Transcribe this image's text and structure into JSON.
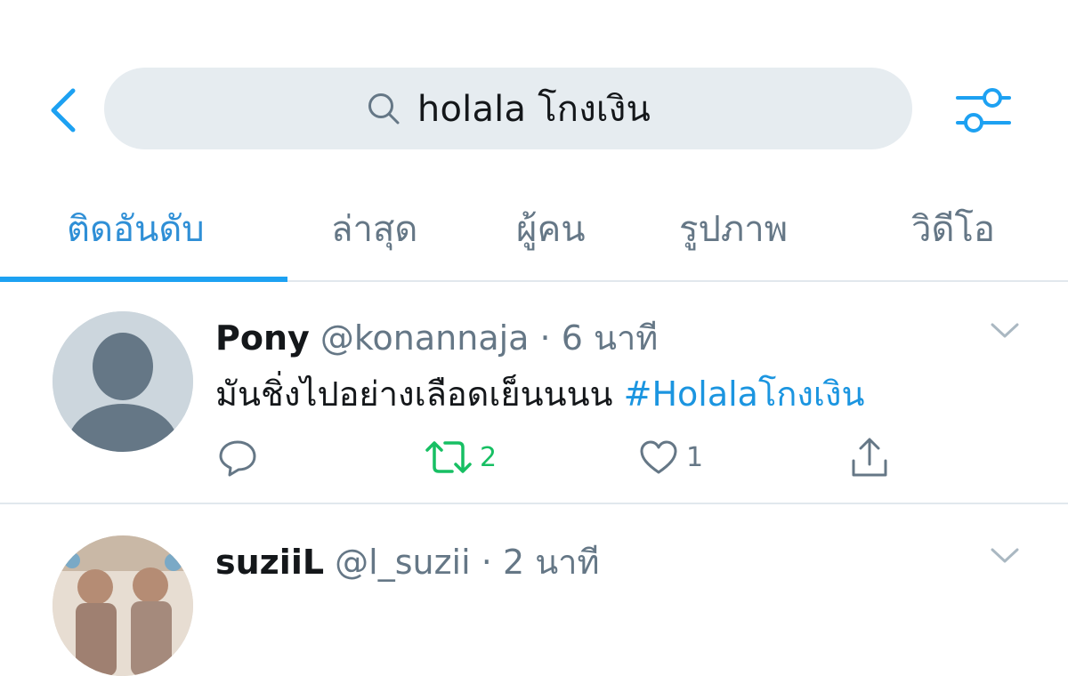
{
  "search": {
    "query": "holala โกงเงิน",
    "icons": {
      "back": "chevron-left-icon",
      "search": "search-icon",
      "filter": "sliders-icon"
    }
  },
  "tabs": [
    {
      "label": "ติดอันดับ",
      "active": true
    },
    {
      "label": "ล่าสุด",
      "active": false
    },
    {
      "label": "ผู้คน",
      "active": false
    },
    {
      "label": "รูปภาพ",
      "active": false
    },
    {
      "label": "วิดีโอ",
      "active": false
    }
  ],
  "colors": {
    "accent": "#1da1f2",
    "retweet": "#17bf63",
    "muted": "#657786",
    "pill": "#e6ecf0"
  },
  "tweets": [
    {
      "name": "Pony",
      "handle": "@konannaja",
      "time": "6 นาที",
      "text": "มันชิ่งไปอย่างเลือดเย็นนนน ",
      "hashtag": "#Holalaโกงเงิน",
      "replies": "",
      "retweets": "2",
      "likes": "1",
      "retweeted": true
    },
    {
      "name": "suziiL",
      "handle": "@l_suzii",
      "time": "2 นาที"
    }
  ]
}
